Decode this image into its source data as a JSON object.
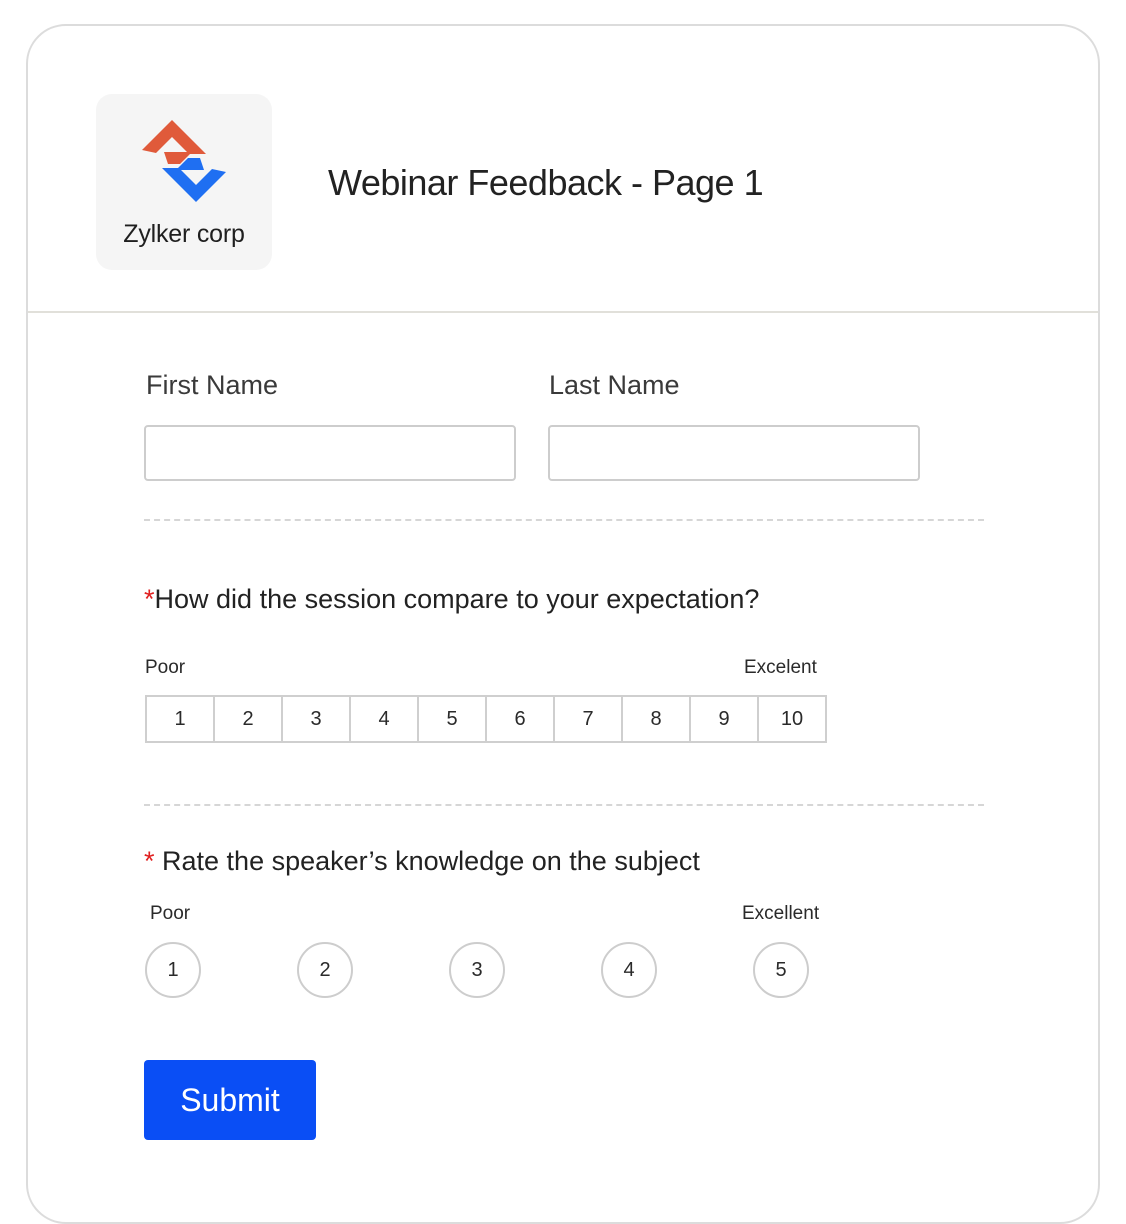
{
  "header": {
    "logo_text": "Zylker corp",
    "title": "Webinar Feedback - Page 1"
  },
  "name_fields": {
    "first_label": "First Name",
    "first_value": "",
    "last_label": "Last Name",
    "last_value": ""
  },
  "q1": {
    "required_mark": "*",
    "text": "How did the session compare to your expectation?",
    "low_label": "Poor",
    "high_label": "Excelent",
    "options": [
      "1",
      "2",
      "3",
      "4",
      "5",
      "6",
      "7",
      "8",
      "9",
      "10"
    ]
  },
  "q2": {
    "required_mark": "*",
    "text": " Rate the speaker’s knowledge on the subject",
    "low_label": "Poor",
    "high_label": "Excellent",
    "options": [
      "1",
      "2",
      "3",
      "4",
      "5"
    ]
  },
  "submit_label": "Submit",
  "colors": {
    "accent": "#0a4ef5",
    "required": "#e02020",
    "logo_orange": "#e05a3a",
    "logo_blue": "#1f6ff2"
  }
}
